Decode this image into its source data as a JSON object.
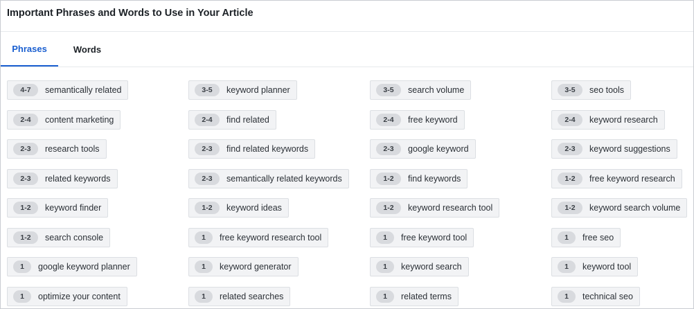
{
  "header": {
    "title": "Important Phrases and Words to Use in Your Article"
  },
  "tabs": [
    {
      "label": "Phrases",
      "active": true
    },
    {
      "label": "Words",
      "active": false
    }
  ],
  "colors": {
    "accent": "#1a5fd0",
    "chip_bg": "#f2f3f5",
    "badge_bg": "#d8dade"
  },
  "phrases": [
    {
      "count": "4-7",
      "text": "semantically related"
    },
    {
      "count": "3-5",
      "text": "keyword planner"
    },
    {
      "count": "3-5",
      "text": "search volume"
    },
    {
      "count": "3-5",
      "text": "seo tools"
    },
    {
      "count": "2-4",
      "text": "content marketing"
    },
    {
      "count": "2-4",
      "text": "find related"
    },
    {
      "count": "2-4",
      "text": "free keyword"
    },
    {
      "count": "2-4",
      "text": "keyword research"
    },
    {
      "count": "2-3",
      "text": "research tools"
    },
    {
      "count": "2-3",
      "text": "find related keywords"
    },
    {
      "count": "2-3",
      "text": "google keyword"
    },
    {
      "count": "2-3",
      "text": "keyword suggestions"
    },
    {
      "count": "2-3",
      "text": "related keywords"
    },
    {
      "count": "2-3",
      "text": "semantically related keywords"
    },
    {
      "count": "1-2",
      "text": "find keywords"
    },
    {
      "count": "1-2",
      "text": "free keyword research"
    },
    {
      "count": "1-2",
      "text": "keyword finder"
    },
    {
      "count": "1-2",
      "text": "keyword ideas"
    },
    {
      "count": "1-2",
      "text": "keyword research tool"
    },
    {
      "count": "1-2",
      "text": "keyword search volume"
    },
    {
      "count": "1-2",
      "text": "search console"
    },
    {
      "count": "1",
      "text": "free keyword research tool"
    },
    {
      "count": "1",
      "text": "free keyword tool"
    },
    {
      "count": "1",
      "text": "free seo"
    },
    {
      "count": "1",
      "text": "google keyword planner"
    },
    {
      "count": "1",
      "text": "keyword generator"
    },
    {
      "count": "1",
      "text": "keyword search"
    },
    {
      "count": "1",
      "text": "keyword tool"
    },
    {
      "count": "1",
      "text": "optimize your content"
    },
    {
      "count": "1",
      "text": "related searches"
    },
    {
      "count": "1",
      "text": "related terms"
    },
    {
      "count": "1",
      "text": "technical seo"
    }
  ]
}
